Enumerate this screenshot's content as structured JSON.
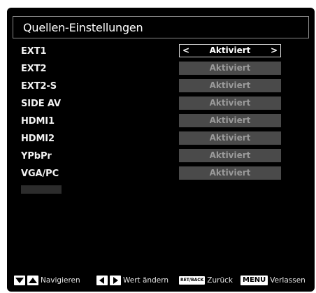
{
  "menu": {
    "title": "Quellen-Einstellungen",
    "sources": [
      {
        "label": "EXT1",
        "value": "Aktiviert",
        "selected": true
      },
      {
        "label": "EXT2",
        "value": "Aktiviert",
        "selected": false
      },
      {
        "label": "EXT2-S",
        "value": "Aktiviert",
        "selected": false
      },
      {
        "label": "SIDE AV",
        "value": "Aktiviert",
        "selected": false
      },
      {
        "label": "HDMI1",
        "value": "Aktiviert",
        "selected": false
      },
      {
        "label": "HDMI2",
        "value": "Aktiviert",
        "selected": false
      },
      {
        "label": "YPbPr",
        "value": "Aktiviert",
        "selected": false
      },
      {
        "label": "VGA/PC",
        "value": "Aktiviert",
        "selected": false
      }
    ],
    "arrow_left": "<",
    "arrow_right": ">"
  },
  "footer": {
    "navigate_label": "Navigieren",
    "change_label": "Wert ändern",
    "return_key": "RET/BACK",
    "return_label": "Zurück",
    "menu_key": "MENU",
    "exit_label": "Verlassen"
  },
  "colors": {
    "background": "#000000",
    "selected_border": "#d8d8d8",
    "disabled_value_bg": "#4a4a4a",
    "text": "#ffffff"
  },
  "icons": {
    "navigate": [
      "down-triangle-icon",
      "up-triangle-icon"
    ],
    "change": [
      "left-triangle-icon",
      "right-triangle-icon"
    ]
  }
}
